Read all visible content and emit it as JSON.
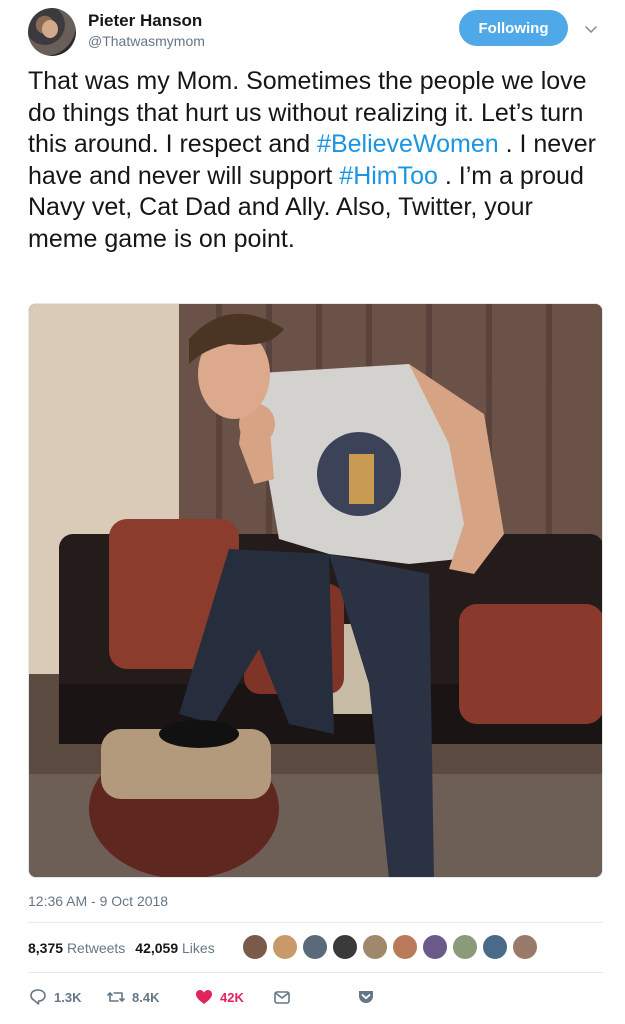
{
  "author": {
    "name": "Pieter Hanson",
    "handle": "@Thatwasmymom"
  },
  "follow_button": {
    "label": "Following"
  },
  "tweet": {
    "text_1": "That was my Mom. Sometimes the people we love do things that hurt us without realizing it. Let’s turn this around. I respect and ",
    "hashtag_1": "#BelieveWomen",
    "text_2": " . I never have and never will support ",
    "hashtag_2": "#HimToo",
    "text_3": " . I’m a proud Navy vet, Cat Dad and Ally. Also, Twitter, your meme game is on point."
  },
  "timestamp": "12:36 AM - 9 Oct 2018",
  "stats": {
    "retweets_count": "8,375",
    "retweets_label": "Retweets",
    "likes_count": "42,059",
    "likes_label": "Likes"
  },
  "likers": [
    "#7a5a4a",
    "#c89a6a",
    "#5a6a7a",
    "#3a3a3a",
    "#a0886a",
    "#b87a5a",
    "#6a5a8a",
    "#8a9a7a",
    "#4a6a8a",
    "#9a7a6a"
  ],
  "actions": {
    "reply_count": "1.3K",
    "retweet_count": "8.4K",
    "like_count": "42K"
  },
  "colors": {
    "accent": "#1b95e0",
    "button": "#4fa8e8",
    "like": "#e0245e",
    "muted": "#657786"
  }
}
